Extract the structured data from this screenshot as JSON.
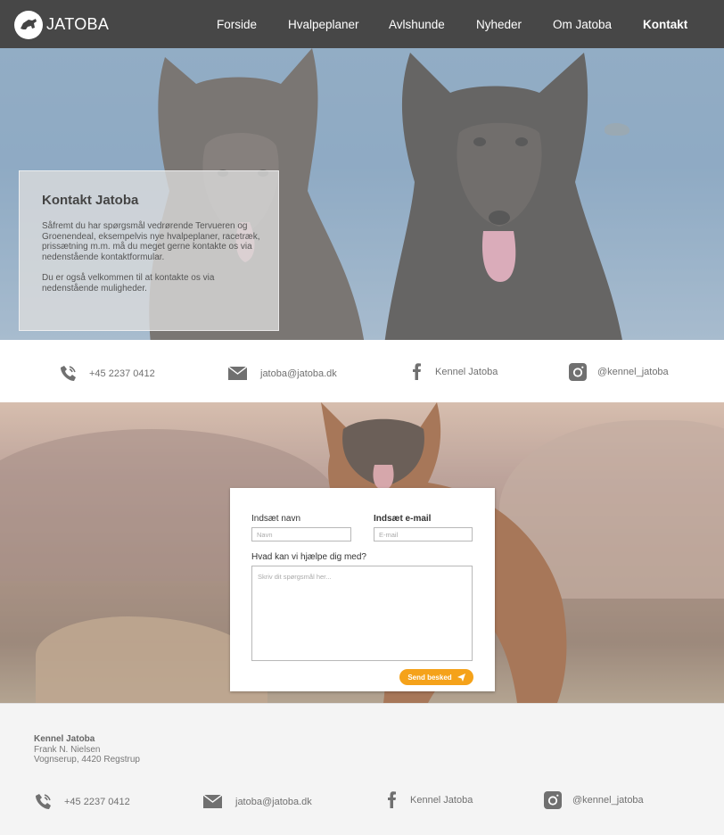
{
  "nav": {
    "brand": "JATOBA",
    "links": [
      "Forside",
      "Hvalpeplaner",
      "Avlshunde",
      "Nyheder",
      "Om Jatoba",
      "Kontakt"
    ],
    "active": "Kontakt"
  },
  "hero": {
    "title": "Kontakt Jatoba",
    "paragraph1": "Såfremt du har spørgsmål vedrørende Tervueren og Groenendeal, eksempelvis nye hvalpeplaner, racetræk, prissætning m.m. må du meget gerne kontakte os via nedenstående kontaktformular.",
    "paragraph2": "Du er også velkommen til at kontakte os via nedenstående muligheder."
  },
  "contact": {
    "phone": "+45 2237 0412",
    "email": "jatoba@jatoba.dk",
    "facebook": "Kennel Jatoba",
    "instagram": "@kennel_jatoba"
  },
  "form": {
    "name_label": "Indsæt navn",
    "name_placeholder": "Navn",
    "email_label": "Indsæt e-mail",
    "email_placeholder": "E-mail",
    "message_label": "Hvad kan vi hjælpe dig med?",
    "message_placeholder": "Skriv dit spørgsmål her...",
    "send_label": "Send besked"
  },
  "footer": {
    "name": "Kennel Jatoba",
    "person": "Frank N. Nielsen",
    "address": "Vognserup, 4420 Regstrup",
    "phone": "+45 2237 0412",
    "email": "jatoba@jatoba.dk",
    "facebook": "Kennel Jatoba",
    "instagram": "@kennel_jatoba"
  },
  "colors": {
    "nav": "#474747",
    "accent": "#f5a21a",
    "icon": "#707070"
  },
  "icons": [
    "logo-icon",
    "phone-icon",
    "mail-icon",
    "facebook-icon",
    "instagram-icon",
    "send-icon"
  ]
}
